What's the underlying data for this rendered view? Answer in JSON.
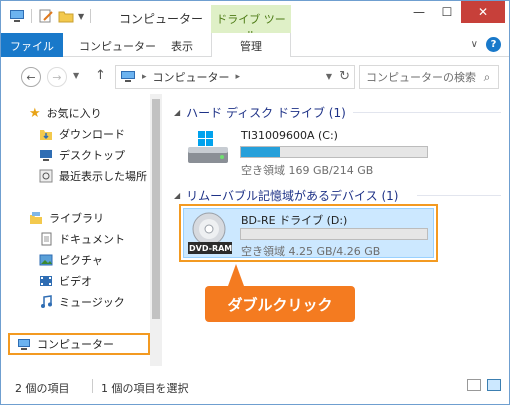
{
  "window": {
    "title": "コンピューター",
    "context_tab_header": "ドライブ ツール",
    "buttons": {
      "minimize": "—",
      "maximize": "☐",
      "close": "✕"
    }
  },
  "ribbon": {
    "tabs": [
      {
        "label": "ファイル"
      },
      {
        "label": "コンピューター"
      },
      {
        "label": "表示"
      },
      {
        "label": "管理"
      }
    ],
    "help": "?"
  },
  "address_bar": {
    "path_label": "コンピューター",
    "search_placeholder": "コンピューターの検索"
  },
  "nav_pane": {
    "favorites": {
      "label": "お気に入り",
      "items": [
        {
          "label": "ダウンロード",
          "icon": "download-folder-icon"
        },
        {
          "label": "デスクトップ",
          "icon": "desktop-icon"
        },
        {
          "label": "最近表示した場所",
          "icon": "recent-places-icon"
        }
      ]
    },
    "libraries": {
      "label": "ライブラリ",
      "items": [
        {
          "label": "ドキュメント",
          "icon": "documents-icon"
        },
        {
          "label": "ピクチャ",
          "icon": "pictures-icon"
        },
        {
          "label": "ビデオ",
          "icon": "videos-icon"
        },
        {
          "label": "ミュージック",
          "icon": "music-icon"
        }
      ]
    },
    "computer": {
      "label": "コンピューター"
    }
  },
  "content": {
    "hdd_group": {
      "header": "ハード ディスク ドライブ (1)",
      "drive": {
        "name": "TI31009600A (C:)",
        "free": "空き領域 169 GB/214 GB",
        "used_fraction": 0.21
      }
    },
    "removable_group": {
      "header": "リムーバブル記憶域があるデバイス (1)",
      "drive": {
        "name": "BD-RE ドライブ (D:)",
        "free": "空き領域 4.25 GB/4.26 GB",
        "used_fraction": 0.0,
        "badge": "DVD-RAM"
      }
    }
  },
  "callout": {
    "label": "ダブルクリック"
  },
  "status_bar": {
    "item_count": "2 個の項目",
    "selected": "1 個の項目を選択"
  },
  "colors": {
    "accent": "#1979ca",
    "highlight_orange": "#f39a21",
    "callout_orange": "#f47b20",
    "selection_blue": "#cce8ff",
    "drive_bar": "#26a0da",
    "group_header": "#1e3287"
  }
}
